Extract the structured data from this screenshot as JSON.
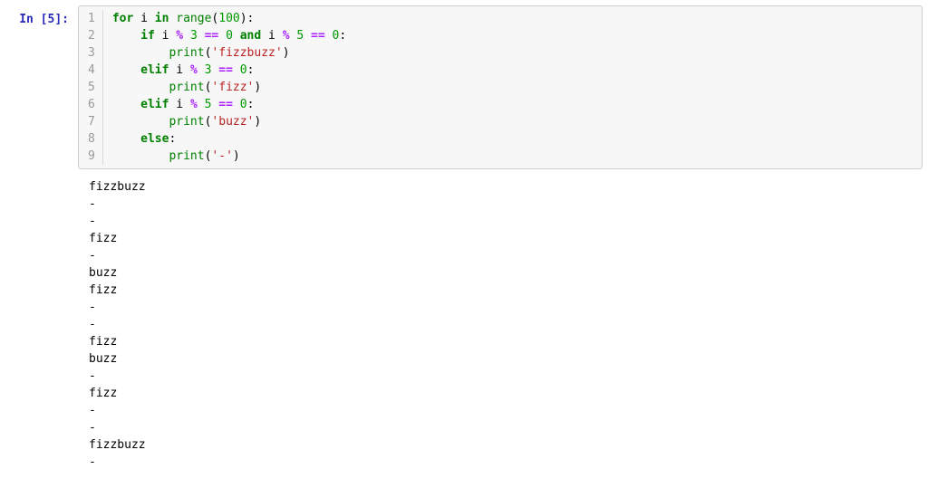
{
  "prompt": {
    "label": "In [5]:"
  },
  "gutter": [
    "1",
    "2",
    "3",
    "4",
    "5",
    "6",
    "7",
    "8",
    "9"
  ],
  "code": {
    "lines": [
      [
        {
          "t": "for ",
          "c": "kw"
        },
        {
          "t": "i ",
          "c": "var"
        },
        {
          "t": "in ",
          "c": "kw"
        },
        {
          "t": "range",
          "c": "call"
        },
        {
          "t": "(",
          "c": "punc"
        },
        {
          "t": "100",
          "c": "num"
        },
        {
          "t": "):",
          "c": "punc"
        }
      ],
      [
        {
          "t": "    ",
          "c": "var"
        },
        {
          "t": "if ",
          "c": "kw"
        },
        {
          "t": "i ",
          "c": "var"
        },
        {
          "t": "% ",
          "c": "op"
        },
        {
          "t": "3 ",
          "c": "num"
        },
        {
          "t": "== ",
          "c": "op"
        },
        {
          "t": "0 ",
          "c": "num"
        },
        {
          "t": "and ",
          "c": "kw"
        },
        {
          "t": "i ",
          "c": "var"
        },
        {
          "t": "% ",
          "c": "op"
        },
        {
          "t": "5 ",
          "c": "num"
        },
        {
          "t": "== ",
          "c": "op"
        },
        {
          "t": "0",
          "c": "num"
        },
        {
          "t": ":",
          "c": "punc"
        }
      ],
      [
        {
          "t": "        ",
          "c": "var"
        },
        {
          "t": "print",
          "c": "call"
        },
        {
          "t": "(",
          "c": "punc"
        },
        {
          "t": "'fizzbuzz'",
          "c": "str"
        },
        {
          "t": ")",
          "c": "punc"
        }
      ],
      [
        {
          "t": "    ",
          "c": "var"
        },
        {
          "t": "elif ",
          "c": "kw"
        },
        {
          "t": "i ",
          "c": "var"
        },
        {
          "t": "% ",
          "c": "op"
        },
        {
          "t": "3 ",
          "c": "num"
        },
        {
          "t": "== ",
          "c": "op"
        },
        {
          "t": "0",
          "c": "num"
        },
        {
          "t": ":",
          "c": "punc"
        }
      ],
      [
        {
          "t": "        ",
          "c": "var"
        },
        {
          "t": "print",
          "c": "call"
        },
        {
          "t": "(",
          "c": "punc"
        },
        {
          "t": "'fizz'",
          "c": "str"
        },
        {
          "t": ")",
          "c": "punc"
        }
      ],
      [
        {
          "t": "    ",
          "c": "var"
        },
        {
          "t": "elif ",
          "c": "kw"
        },
        {
          "t": "i ",
          "c": "var"
        },
        {
          "t": "% ",
          "c": "op"
        },
        {
          "t": "5 ",
          "c": "num"
        },
        {
          "t": "== ",
          "c": "op"
        },
        {
          "t": "0",
          "c": "num"
        },
        {
          "t": ":",
          "c": "punc"
        }
      ],
      [
        {
          "t": "        ",
          "c": "var"
        },
        {
          "t": "print",
          "c": "call"
        },
        {
          "t": "(",
          "c": "punc"
        },
        {
          "t": "'buzz'",
          "c": "str"
        },
        {
          "t": ")",
          "c": "punc"
        }
      ],
      [
        {
          "t": "    ",
          "c": "var"
        },
        {
          "t": "else",
          "c": "kw"
        },
        {
          "t": ":",
          "c": "punc"
        }
      ],
      [
        {
          "t": "        ",
          "c": "var"
        },
        {
          "t": "print",
          "c": "call"
        },
        {
          "t": "(",
          "c": "punc"
        },
        {
          "t": "'-'",
          "c": "str"
        },
        {
          "t": ")",
          "c": "punc"
        }
      ]
    ]
  },
  "output_lines": [
    "fizzbuzz",
    "-",
    "-",
    "fizz",
    "-",
    "buzz",
    "fizz",
    "-",
    "-",
    "fizz",
    "buzz",
    "-",
    "fizz",
    "-",
    "-",
    "fizzbuzz",
    "-"
  ]
}
